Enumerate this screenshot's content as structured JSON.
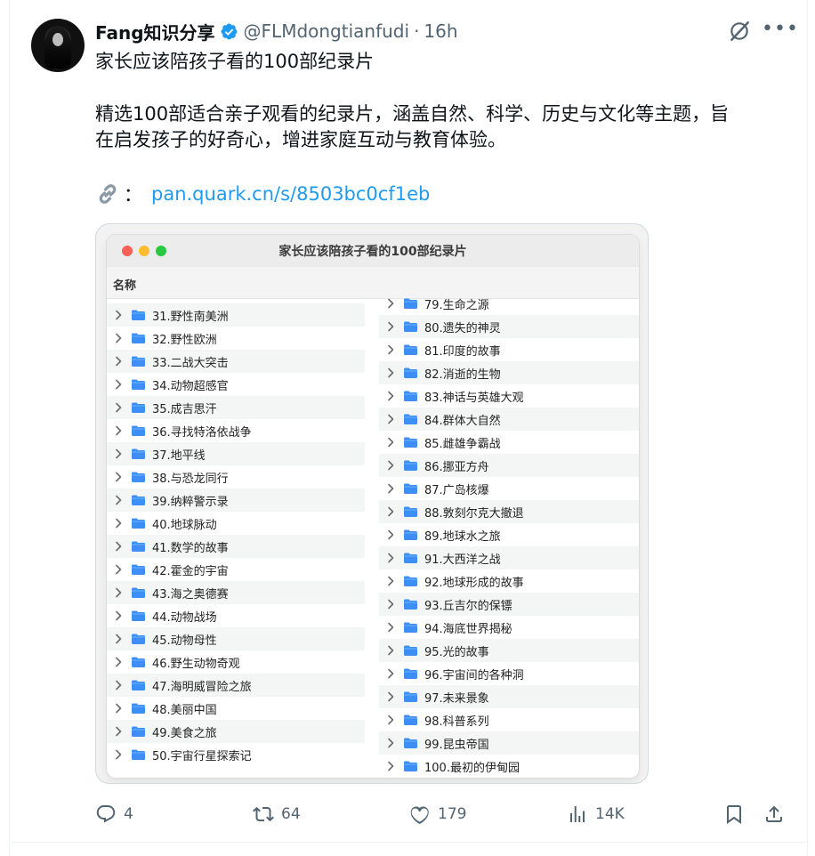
{
  "author": {
    "name": "Fang知识分享",
    "handle": "@FLMdongtianfudi",
    "separator": "·",
    "time": "16h"
  },
  "tweet": {
    "title": "家长应该陪孩子看的100部纪录片",
    "body_line1": "精选100部适合亲子观看的纪录片，涵盖自然、科学、历史与文化等主题，旨",
    "body_line2": "在启发孩子的好奇心，增进家庭互动与教育体验。",
    "link_colon": "：",
    "link_url": "pan.quark.cn/s/8503bc0cf1eb"
  },
  "finder": {
    "window_title": "家长应该陪孩子看的100部纪录片",
    "column_header": "名称",
    "left_items": [
      "31.野性南美洲",
      "32.野性欧洲",
      "33.二战大突击",
      "34.动物超感官",
      "35.成吉思汗",
      "36.寻找特洛依战争",
      "37.地平线",
      "38.与恐龙同行",
      "39.纳粹警示录",
      "40.地球脉动",
      "41.数学的故事",
      "42.霍金的宇宙",
      "43.海之奥德赛",
      "44.动物战场",
      "45.动物母性",
      "46.野生动物奇观",
      "47.海明威冒险之旅",
      "48.美丽中国",
      "49.美食之旅",
      "50.宇宙行星探索记"
    ],
    "right_items": [
      "79.生命之源",
      "80.遗失的神灵",
      "81.印度的故事",
      "82.消逝的生物",
      "83.神话与英雄大观",
      "84.群体大自然",
      "85.雌雄争霸战",
      "86.挪亚方舟",
      "87.广岛核爆",
      "88.敦刻尔克大撤退",
      "89.地球水之旅",
      "91.大西洋之战",
      "92.地球形成的故事",
      "93.丘吉尔的保镖",
      "94.海底世界揭秘",
      "95.光的故事",
      "96.宇宙间的各种洞",
      "97.未来景象",
      "98.科普系列",
      "99.昆虫帝国",
      "100.最初的伊甸园"
    ]
  },
  "stats": {
    "replies": "4",
    "retweets": "64",
    "likes": "179",
    "views": "14K"
  },
  "colors": {
    "link": "#1d9bf0",
    "secondary_text": "#536471",
    "verified": "#1d9bf0",
    "folder": "#3d8ef5"
  },
  "icons": [
    "verified-badge-icon",
    "grok-icon",
    "more-icon",
    "link-icon",
    "chevron-right-icon",
    "folder-icon",
    "reply-icon",
    "retweet-icon",
    "like-icon",
    "views-icon",
    "bookmark-icon",
    "share-icon"
  ]
}
